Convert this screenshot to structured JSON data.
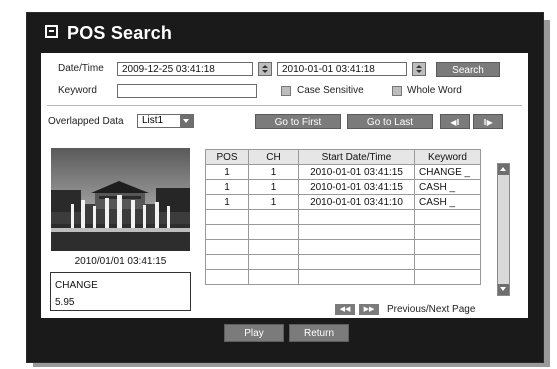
{
  "window": {
    "title": "POS Search"
  },
  "search": {
    "datetime_label": "Date/Time",
    "start_datetime": "2009-12-25  03:41:18",
    "end_datetime": "2010-01-01  03:41:18",
    "search_button": "Search",
    "keyword_label": "Keyword",
    "keyword_value": "",
    "case_sensitive_label": "Case Sensitive",
    "whole_word_label": "Whole Word"
  },
  "overlap": {
    "label": "Overlapped Data",
    "selected": "List1",
    "go_first": "Go to First",
    "go_last": "Go to Last",
    "prev_frame_icon": "step-back-icon",
    "next_frame_icon": "step-forward-icon"
  },
  "preview": {
    "timestamp": "2010/01/01  03:41:15",
    "text_line1": "CHANGE",
    "text_line2": "5.95"
  },
  "table": {
    "headers": [
      "POS",
      "CH",
      "Start Date/Time",
      "Keyword"
    ],
    "rows": [
      [
        "1",
        "1",
        "2010-01-01 03:41:15",
        "CHANGE _"
      ],
      [
        "1",
        "1",
        "2010-01-01 03:41:15",
        "CASH _"
      ],
      [
        "1",
        "1",
        "2010-01-01 03:41:10",
        "CASH _"
      ],
      [
        "",
        "",
        "",
        ""
      ],
      [
        "",
        "",
        "",
        ""
      ],
      [
        "",
        "",
        "",
        ""
      ],
      [
        "",
        "",
        "",
        ""
      ],
      [
        "",
        "",
        "",
        ""
      ]
    ]
  },
  "pagination": {
    "label": "Previous/Next Page",
    "prev_icon": "rewind-icon",
    "next_icon": "fast-forward-icon"
  },
  "footer": {
    "play": "Play",
    "return": "Return"
  }
}
